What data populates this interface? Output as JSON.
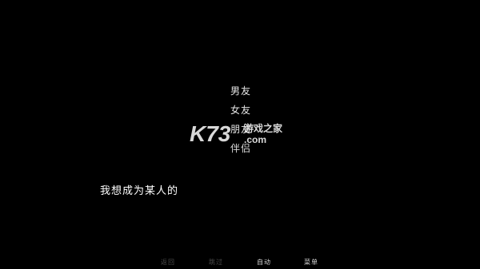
{
  "choices": [
    {
      "label": "男友"
    },
    {
      "label": "女友"
    },
    {
      "label": "朋友"
    },
    {
      "label": "伴侣"
    }
  ],
  "dialogue": {
    "text": "我想成为某人的"
  },
  "quick_menu": {
    "back": "返回",
    "skip": "跳过",
    "auto": "自动",
    "menu": "菜单"
  },
  "watermark": {
    "brand": "K73",
    "tagline": "游戏之家",
    "domain": ".com"
  },
  "colors": {
    "background": "#000000",
    "text": "#ffffff",
    "menu_dim": "#4a4a4a",
    "menu_active": "#d8d8d8"
  }
}
